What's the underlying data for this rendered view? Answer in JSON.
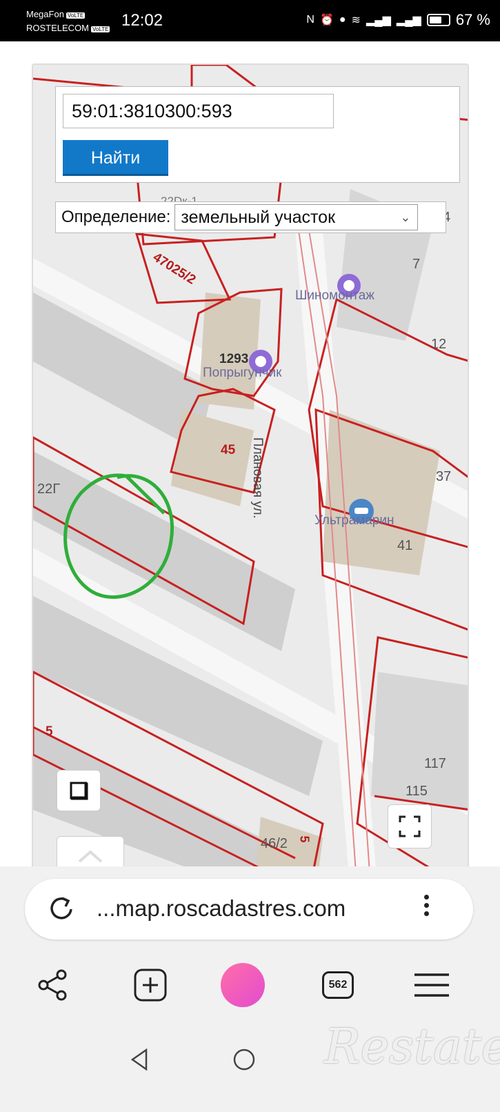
{
  "status_bar": {
    "carrier1": "MegaFon",
    "carrier2": "ROSTELECOM",
    "carrier_tag": "VoLTE",
    "time": "12:02",
    "battery": "67 %"
  },
  "search": {
    "cadastral_number": "59:01:3810300:593",
    "find_label": "Найти"
  },
  "definition": {
    "label": "Определение:",
    "selected": "земельный участок"
  },
  "map": {
    "labels": {
      "parcel_47025": "47025/2",
      "l_22dk": "22Dк-1",
      "n4": "4",
      "n7": "7",
      "n12": "12",
      "n1293": "1293",
      "n45": "45",
      "n22g": "22Г",
      "n37": "37",
      "n41": "41",
      "n5": "5",
      "n117": "117",
      "n115": "115",
      "n46_2": "46/2",
      "n5b": "5"
    },
    "pois": {
      "tire": "Шиномонтаж",
      "kid": "Попрыгунчик",
      "car": "Ультрамарин"
    },
    "street": "Плановая ул.",
    "colors": {
      "parcel_border": "#c82020",
      "highlight_circle": "#2fae3a",
      "building": "#cfcfcf",
      "road": "#f7f7f7"
    }
  },
  "browser": {
    "url": "...map.roscadastres.com",
    "tab_count": "562"
  },
  "watermark": "Restate"
}
